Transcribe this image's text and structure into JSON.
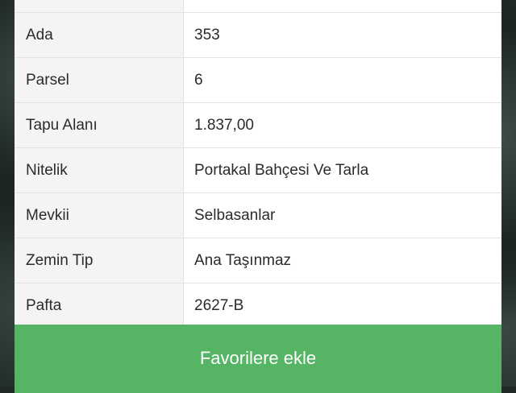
{
  "details": {
    "rows": [
      {
        "label": "",
        "value": ""
      },
      {
        "label": "Ada",
        "value": "353"
      },
      {
        "label": "Parsel",
        "value": "6"
      },
      {
        "label": "Tapu Alanı",
        "value": "1.837,00"
      },
      {
        "label": "Nitelik",
        "value": "Portakal Bahçesi Ve Tarla"
      },
      {
        "label": "Mevkii",
        "value": "Selbasanlar"
      },
      {
        "label": "Zemin Tip",
        "value": "Ana Taşınmaz"
      },
      {
        "label": "Pafta",
        "value": "2627-B"
      }
    ]
  },
  "actions": {
    "favorite_label": "Favorilere ekle"
  },
  "colors": {
    "button_green": "#56b565",
    "label_bg": "#f4f4f4"
  }
}
